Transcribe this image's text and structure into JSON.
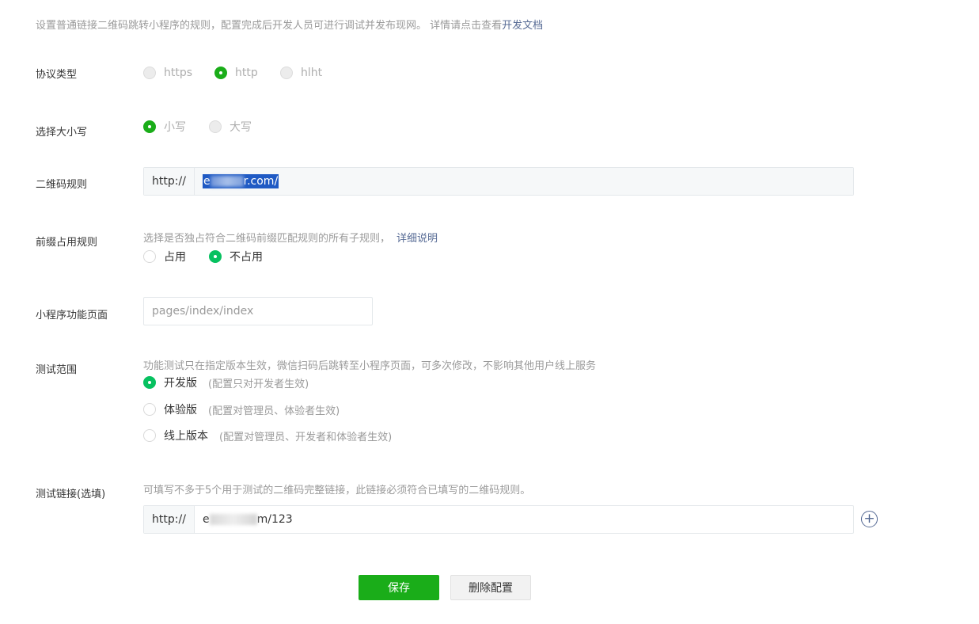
{
  "description": {
    "text": "设置普通链接二维码跳转小程序的规则，配置完成后开发人员可进行调试并发布现网。 详情请点击查看",
    "doc_link": "开发文档"
  },
  "protocol": {
    "label": "协议类型",
    "options": [
      "https",
      "http",
      "hlht"
    ],
    "selected": "http"
  },
  "case": {
    "label": "选择大小写",
    "options": [
      "小写",
      "大写"
    ],
    "selected": "小写"
  },
  "qr_rule": {
    "label": "二维码规则",
    "prefix": "http://",
    "value_start": "e",
    "value_end": "r.com/"
  },
  "prefix_rule": {
    "label": "前缀占用规则",
    "hint": "选择是否独占符合二维码前缀匹配规则的所有子规则，",
    "hint_link": "详细说明",
    "options": [
      "占用",
      "不占用"
    ],
    "selected": "不占用"
  },
  "page": {
    "label": "小程序功能页面",
    "placeholder": "pages/index/index"
  },
  "test_scope": {
    "label": "测试范围",
    "hint": "功能测试只在指定版本生效，微信扫码后跳转至小程序页面，可多次修改，不影响其他用户线上服务",
    "options": [
      {
        "name": "开发版",
        "note": "(配置只对开发者生效)"
      },
      {
        "name": "体验版",
        "note": "(配置对管理员、体验者生效)"
      },
      {
        "name": "线上版本",
        "note": "(配置对管理员、开发者和体验者生效)"
      }
    ],
    "selected": "开发版"
  },
  "test_link": {
    "label": "测试链接(选填)",
    "hint": "可填写不多于5个用于测试的二维码完整链接，此链接必须符合已填写的二维码规则。",
    "prefix": "http://",
    "value_start": "e",
    "value_end": "m/123",
    "add_icon": "plus-circle-icon"
  },
  "buttons": {
    "save": "保存",
    "delete": "删除配置"
  },
  "colors": {
    "primary_green": "#1aad19",
    "radio_green": "#07c160",
    "link_blue": "#576b95",
    "selection_blue": "#1f5ac4"
  }
}
